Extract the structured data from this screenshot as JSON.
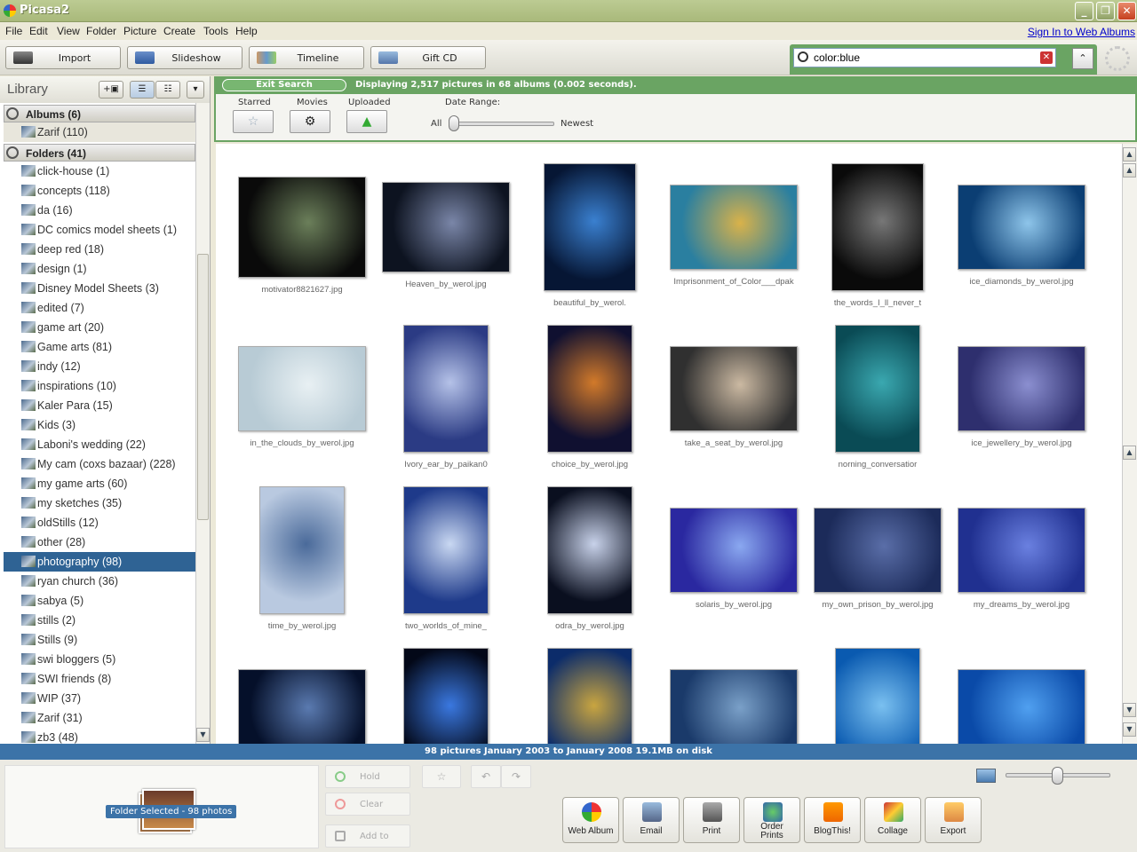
{
  "window": {
    "title": "Picasa2"
  },
  "menu": [
    "File",
    "Edit",
    "View",
    "Folder",
    "Picture",
    "Create",
    "Tools",
    "Help"
  ],
  "signin": "Sign In to Web Albums",
  "toolbar": {
    "import": "Import",
    "slideshow": "Slideshow",
    "timeline": "Timeline",
    "giftcd": "Gift CD"
  },
  "search": {
    "value": "color:blue"
  },
  "library": {
    "title": "Library",
    "albums_header": "Albums (6)",
    "albums": [
      {
        "label": "Zarif (110)"
      }
    ],
    "folders_header": "Folders (41)",
    "folders": [
      {
        "label": "click-house (1)"
      },
      {
        "label": "concepts (118)"
      },
      {
        "label": "da (16)"
      },
      {
        "label": "DC comics model sheets (1)"
      },
      {
        "label": "deep red (18)"
      },
      {
        "label": "design (1)"
      },
      {
        "label": "Disney Model Sheets (3)"
      },
      {
        "label": "edited (7)"
      },
      {
        "label": "game art (20)"
      },
      {
        "label": "Game arts (81)"
      },
      {
        "label": "indy (12)"
      },
      {
        "label": "inspirations (10)"
      },
      {
        "label": "Kaler Para (15)"
      },
      {
        "label": "Kids (3)"
      },
      {
        "label": "Laboni's wedding (22)"
      },
      {
        "label": "My cam (coxs bazaar) (228)"
      },
      {
        "label": "my game arts (60)"
      },
      {
        "label": "my sketches (35)"
      },
      {
        "label": "oldStills (12)"
      },
      {
        "label": "other (28)"
      },
      {
        "label": "photography (98)",
        "selected": true
      },
      {
        "label": "ryan church (36)"
      },
      {
        "label": "sabya (5)"
      },
      {
        "label": "stills (2)"
      },
      {
        "label": "Stills (9)"
      },
      {
        "label": "swi bloggers (5)"
      },
      {
        "label": "SWI friends (8)"
      },
      {
        "label": "WIP (37)"
      },
      {
        "label": "Zarif (31)"
      },
      {
        "label": "zb3 (48)"
      }
    ]
  },
  "searchbar": {
    "exit_label": "Exit Search",
    "message": "Displaying 2,517 pictures in 68 albums (0.002 seconds).",
    "starred": "Starred",
    "movies": "Movies",
    "uploaded": "Uploaded",
    "date_range": "Date Range:",
    "all": "All",
    "newest": "Newest"
  },
  "photos": [
    {
      "caption": "motivator8821627.jpg",
      "colors": [
        "#0a0a0a",
        "#6b7f5a"
      ]
    },
    {
      "caption": "Heaven_by_werol.jpg",
      "colors": [
        "#0d1320",
        "#7a86a8"
      ]
    },
    {
      "caption": "beautiful_by_werol.",
      "colors": [
        "#061634",
        "#3a80d0"
      ]
    },
    {
      "caption": "Imprisonment_of_Color___dpak",
      "colors": [
        "#2a7fa0",
        "#d9b24a"
      ]
    },
    {
      "caption": "the_words_I_ll_never_t",
      "colors": [
        "#0a0a0a",
        "#777"
      ]
    },
    {
      "caption": "ice_diamonds_by_werol.jpg",
      "colors": [
        "#0b3e73",
        "#8ec5ea"
      ]
    },
    {
      "caption": "in_the_clouds_by_werol.jpg",
      "colors": [
        "#b8cbd5",
        "#e8f0f3"
      ]
    },
    {
      "caption": "Ivory_ear_by_paikan0",
      "colors": [
        "#2b3b84",
        "#b5c2e8"
      ]
    },
    {
      "caption": "choice_by_werol.jpg",
      "colors": [
        "#101030",
        "#d27a2a"
      ]
    },
    {
      "caption": "take_a_seat_by_werol.jpg",
      "colors": [
        "#303030",
        "#cbb9a2"
      ]
    },
    {
      "caption": "norning_conversatior",
      "colors": [
        "#0a4b55",
        "#3aa8b0"
      ]
    },
    {
      "caption": "ice_jewellery_by_werol.jpg",
      "colors": [
        "#2e2f6e",
        "#8b8fd0"
      ]
    },
    {
      "caption": "time_by_werol.jpg",
      "colors": [
        "#b9c9e0",
        "#4a6a9a"
      ]
    },
    {
      "caption": "two_worlds_of_mine_",
      "colors": [
        "#1e3a8a",
        "#c9d8f2"
      ]
    },
    {
      "caption": "odra_by_werol.jpg",
      "colors": [
        "#0a0f1f",
        "#c8d2ea"
      ]
    },
    {
      "caption": "solaris_by_werol.jpg",
      "colors": [
        "#2a28a0",
        "#8aa8f0"
      ]
    },
    {
      "caption": "my_own_prison_by_werol.jpg",
      "colors": [
        "#1c2b5a",
        "#5a6ea8"
      ]
    },
    {
      "caption": "my_dreams_by_werol.jpg",
      "colors": [
        "#203090",
        "#6a80e0"
      ]
    },
    {
      "caption": "",
      "colors": [
        "#05102a",
        "#5a7ab0"
      ]
    },
    {
      "caption": "",
      "colors": [
        "#030818",
        "#3a78e0"
      ]
    },
    {
      "caption": "",
      "colors": [
        "#0c2c6a",
        "#c9a540"
      ]
    },
    {
      "caption": "",
      "colors": [
        "#1a3a6a",
        "#7aa0c8"
      ]
    },
    {
      "caption": "",
      "colors": [
        "#0a5ab0",
        "#7ac0f0"
      ]
    },
    {
      "caption": "",
      "colors": [
        "#0a4aa8",
        "#50a0f0"
      ]
    }
  ],
  "status": {
    "text": "98 pictures     January 2003 to January 2008     19.1MB on disk"
  },
  "tray": {
    "badge": "Folder Selected - 98 photos",
    "hold": "Hold",
    "clear": "Clear",
    "addto": "Add to"
  },
  "actions": [
    "Web Album",
    "Email",
    "Print",
    "Order\nPrints",
    "BlogThis!",
    "Collage",
    "Export"
  ]
}
